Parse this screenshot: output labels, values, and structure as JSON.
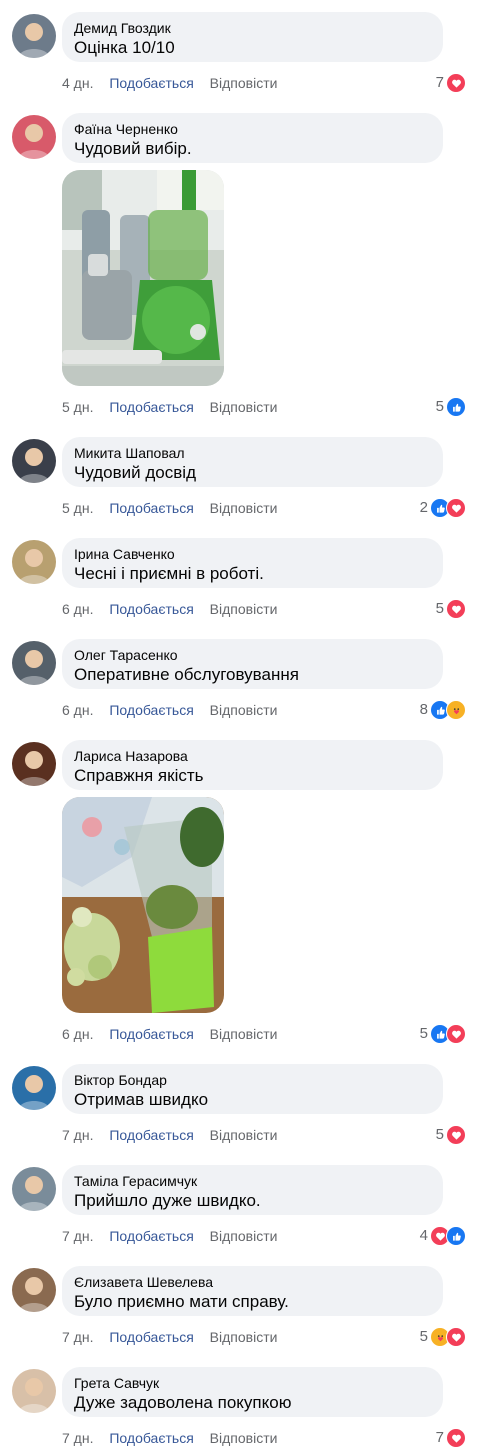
{
  "actions": {
    "like_label": "Подобається",
    "reply_label": "Відповісти"
  },
  "colors": {
    "like_link": "#385898",
    "bubble": "#f0f2f5",
    "like_icon": "#1877f2",
    "love_icon": "#f33e58",
    "care_icon": "#f7b125"
  },
  "comments": [
    {
      "author": "Демид Гвоздик",
      "text": "Оцінка 10/10",
      "time": "4 дн.",
      "count": "7",
      "reactions": [
        "love"
      ],
      "avatar": "#6d7b8a",
      "photo": null
    },
    {
      "author": "Фаїна Черненко",
      "text": "Чудовий вибір.",
      "time": "5 дн.",
      "count": "5",
      "reactions": [
        "like"
      ],
      "avatar": "#d85a6a",
      "photo": "juicer-photo"
    },
    {
      "author": "Микита Шаповал",
      "text": "Чудовий досвід",
      "time": "5 дн.",
      "count": "2",
      "reactions": [
        "like",
        "love"
      ],
      "avatar": "#3a3f4a",
      "photo": null
    },
    {
      "author": "Ірина Савченко",
      "text": "Чесні і приємні в роботі.",
      "time": "6 дн.",
      "count": "5",
      "reactions": [
        "love"
      ],
      "avatar": "#b8a070",
      "photo": null
    },
    {
      "author": "Олег Тарасенко",
      "text": "Оперативне обслуговування",
      "time": "6 дн.",
      "count": "8",
      "reactions": [
        "like",
        "care"
      ],
      "avatar": "#55606a",
      "photo": null
    },
    {
      "author": "Лариса Назарова",
      "text": "Справжня якість",
      "time": "6 дн.",
      "count": "5",
      "reactions": [
        "like",
        "love"
      ],
      "avatar": "#5a3020",
      "photo": "blender-photo"
    },
    {
      "author": "Віктор Бондар",
      "text": "Отримав швидко",
      "time": "7 дн.",
      "count": "5",
      "reactions": [
        "love"
      ],
      "avatar": "#2a6fa8",
      "photo": null
    },
    {
      "author": "Таміла Герасимчук",
      "text": "Прийшло дуже швидко.",
      "time": "7 дн.",
      "count": "4",
      "reactions": [
        "love",
        "like"
      ],
      "avatar": "#7a8c9a",
      "photo": null
    },
    {
      "author": "Єлизавета Шевелева",
      "text": "Було приємно мати справу.",
      "time": "7 дн.",
      "count": "5",
      "reactions": [
        "care",
        "love"
      ],
      "avatar": "#8a6a50",
      "photo": null
    },
    {
      "author": "Грета Савчук",
      "text": "Дуже задоволена покупкою",
      "time": "7 дн.",
      "count": "7",
      "reactions": [
        "love"
      ],
      "avatar": "#d8c0a8",
      "photo": null
    }
  ]
}
